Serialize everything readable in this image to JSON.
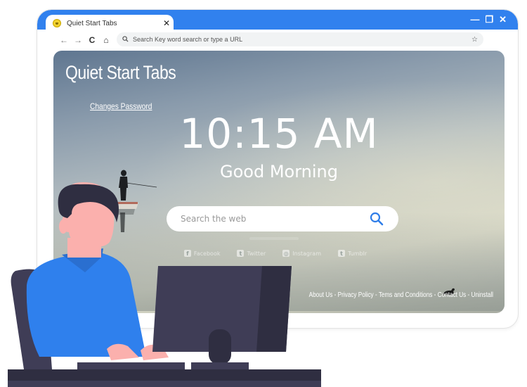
{
  "browser": {
    "tab_title": "Quiet Start Tabs",
    "tab_close": "✕",
    "window_controls": {
      "minimize": "—",
      "restore": "❐",
      "close": "✕"
    },
    "nav": {
      "back": "←",
      "forward": "→",
      "reload": "C",
      "home": "⌂"
    },
    "address_placeholder": "Search Key word search or type a URL",
    "bookmark_star": "☆"
  },
  "page": {
    "brand": "Quiet Start Tabs",
    "change_password": "Changes Password",
    "clock": "10:15 AM",
    "greeting": "Good Morning",
    "search_placeholder": "Search the web",
    "socials": [
      {
        "label": "Facebook",
        "icon": "f"
      },
      {
        "label": "Twitter",
        "icon": "t"
      },
      {
        "label": "Instagram",
        "icon": "◎"
      },
      {
        "label": "Tumblr",
        "icon": "t"
      }
    ],
    "footer_links": [
      "About Us",
      "Privacy Policy",
      "Tems and Conditions",
      "Contact Us",
      "Uninstall"
    ],
    "footer_separator": " - "
  },
  "colors": {
    "titlebar": "#3181ee",
    "search_icon": "#2f7de8",
    "shirt": "#2f80ed",
    "monitor": "#3f3d56",
    "skin": "#fbb0ad",
    "hair": "#2f2e41"
  }
}
